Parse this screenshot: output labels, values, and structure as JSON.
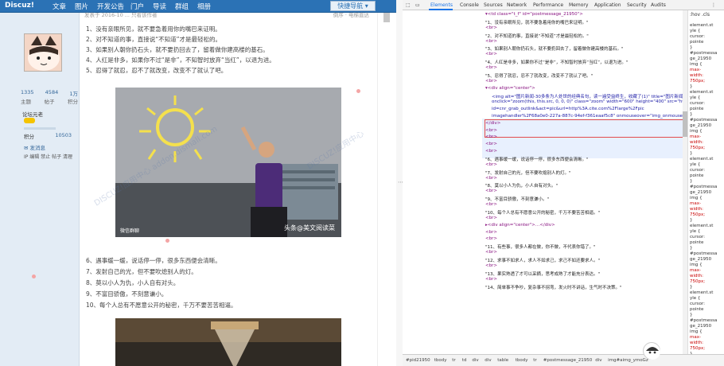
{
  "forum": {
    "logo": "Discuz!",
    "nav": [
      "文章",
      "图片",
      "开发公告",
      "门户",
      "导读",
      "群组",
      "相册"
    ],
    "quick_nav_label": "快捷导航",
    "sidebar": {
      "stats": [
        [
          "1335",
          "4584",
          "1万"
        ],
        [
          "主题",
          "帖子",
          "积分"
        ]
      ],
      "rank_label": "论坛元老",
      "points_label": "积分",
      "points_value": "10503",
      "pm_label": "发消息",
      "actions": "IP 编辑 禁止 帖子 清理"
    },
    "post_meta": "发表于 2016-10 ... 只看该作者",
    "post_meta_right": "倒序 · 电梯直达",
    "paragraphs_top": [
      "1、没有亲眼所见，就不要急着用你的嘴巴来证明。",
      "2、对不知道的事，直接说“不知道”才是最轻松的。",
      "3、如果别人朝你扔石头，就不要扔回去了，留着做你建高楼的基石。",
      "4、人红是非多，如果你不过“是非”，不知智时放弃“当红”，以退为进。",
      "5、忍得了就忍，忍不了就改变，改变不了就认了吧。"
    ],
    "photo1_caption": "头条@美文阅读菜",
    "photo1_corner": "微信群聊",
    "paragraphs_bottom": [
      "6、遇事缓一缓，说话停一停，很多东西便会清晰。",
      "7、发射自己的光，但不要吹熄别人的灯。",
      "8、莫以小人为仇，小人自有对头。",
      "9、不富目骄傲，不刻意谦小。",
      "10、每个人总有不愿意公开的秘密，千万不要苦苦相逼。"
    ]
  },
  "devtools": {
    "tabs": [
      "Elements",
      "Console",
      "Sources",
      "Network",
      "Performance",
      "Memory",
      "Application",
      "Security",
      "Audits"
    ],
    "active_tab": "Elements",
    "dom_lines": [
      "▾<td class=\"t_f\" id=\"postmessage_21950\">",
      "\"1、没有亲眼所见，就不要急着用你的嘴巴来证明。\"",
      "<br>",
      "\"2、对不知道的事，直接说“不知道”才是最轻松的。\"",
      "<br>",
      "\"3、如果别人朝你扔石头，就不要扔回去了，留着做你建高楼的基石。\"",
      "<br>",
      "\"4、人红是非多，如果你不过“是非”，不知智时放弃“当红”，以退为进。\"",
      "<br>",
      "\"5、忍得了就忍，忍不了就改变，改变不了就认了吧。\"",
      "<br>",
      "▾<div align=\"center\">",
      "<img alt=\"图片新闻-30多条为人处世的经典名句，读一遍受益终生，收藏了(1)\" title=\"图片新闻-30多条为人处世的经典名句，读一遍受益终生，收藏了(1)\" id=\"aimg_ymoGz\"",
      "onclick=\"zoom(this, this.src, 0, 0, 0)\" class=\"zoom\" width=\"600\" height=\"400\" src=\"http://cnr.discuz.com/plugin.php?",
      "id=cnr_grab_outlink&act=pic&url=http%3A.cite.com%2Flarge%2Fpic",
      "imagehandler%2F68a0e0-227a-887c-94ef-f361eaaf5c8\" onmouseover=\"img_onmouseoverfunc(this)\" style=\"cursor:pointer\" border=\"0\"> == $0",
      "</div>",
      "<br>",
      "<br>",
      "<br>",
      "<br>",
      "\"6、遇事缓一缓，说话停一停，很多东西便会清晰。\"",
      "<br>",
      "\"7、发射自己的光，但不要吹熄别人的灯。\"",
      "<br>",
      "\"8、莫以小人为仇，小人自有对头。\"",
      "<br>",
      "\"9、不富目骄傲，不刻意谦小。\"",
      "<br>",
      "\"10、每个人总有不愿意公开的秘密，千万不要苦苦相逼。\"",
      "<br>",
      "▸<div align=\"center\">…</div>",
      "<br>",
      "<br>",
      "\"11、有些事，很多人都在做，你不做，不代表你错了。\"",
      "<br>",
      "\"12、求事不如求人，求人不如求己，求己不如还要求人。\"",
      "<br>",
      "\"13、果实熟透了才可以采摘，思考成熟了才能充分表达。\"",
      "<br>",
      "\"14、简单事不争吵，复杂事不拐弯，发火时不讲话，生气时不决策。\""
    ],
    "styles_header": ":hov .cls",
    "styles_lines": [
      "element.st",
      "yle {",
      "  cursor:",
      "  pointe",
      "}",
      "#postmessa",
      "ge_21950",
      "img {",
      "  max-",
      "  width:",
      "  750px;",
      "}"
    ],
    "breadcrumb": [
      "#pid21950",
      "tbody",
      "tr",
      "td",
      "div",
      "div",
      "table",
      "tbody",
      "tr",
      "#postmessage_21950",
      "div",
      "img#aimg_ymoGz"
    ]
  }
}
